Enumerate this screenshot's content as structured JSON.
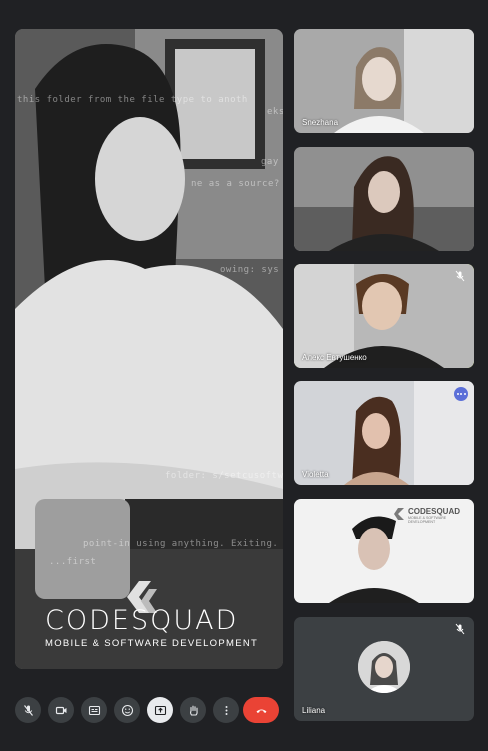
{
  "main": {
    "code_lines": [
      "this folder from the file type to anoth",
      "eks",
      "gay",
      "ne as a source?",
      "owing: sys",
      "folder: s/setcusoftware",
      "point-in using anything. Exiting.",
      "...first"
    ],
    "brand_title": "CODESQUAD",
    "brand_subtitle": "MOBILE & SOFTWARE DEVELOPMENT"
  },
  "participants": [
    {
      "name": "Snezhana",
      "active": false
    },
    {
      "name": "",
      "active": false
    },
    {
      "name": "Алекс Евтушенко",
      "active": true,
      "muted": true
    },
    {
      "name": "Violetta",
      "active": false,
      "menu": true
    },
    {
      "name": "",
      "active": false,
      "logo_text": "CODESQUAD",
      "logo_sub": "MOBILE & SOFTWARE DEVELOPMENT"
    },
    {
      "name": "Liliana",
      "active": false,
      "muted": true
    }
  ],
  "toolbar": {
    "buttons": [
      "mic-off-icon",
      "camera-icon",
      "captions-icon",
      "emoji-icon",
      "present-icon",
      "raise-hand-icon",
      "more-icon",
      "hang-up-icon"
    ]
  },
  "colors": {
    "background": "#202124",
    "active_border": "#c6f24e",
    "end_call": "#ea4335",
    "tile_bg": "#3c4043"
  }
}
